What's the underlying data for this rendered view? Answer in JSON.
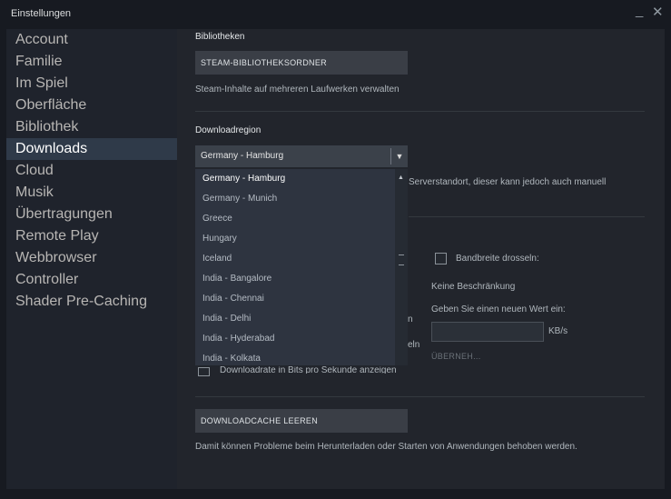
{
  "window": {
    "title": "Einstellungen",
    "minimize_glyph": "_",
    "close_glyph": "✕"
  },
  "sidebar": {
    "items": [
      {
        "label": "Account"
      },
      {
        "label": "Familie"
      },
      {
        "label": "Im Spiel"
      },
      {
        "label": "Oberfläche"
      },
      {
        "label": "Bibliothek"
      },
      {
        "label": "Downloads",
        "active": true
      },
      {
        "label": "Cloud"
      },
      {
        "label": "Musik"
      },
      {
        "label": "Übertragungen"
      },
      {
        "label": "Remote Play"
      },
      {
        "label": "Webbrowser"
      },
      {
        "label": "Controller"
      },
      {
        "label": "Shader Pre-Caching"
      }
    ]
  },
  "libraries": {
    "title": "Bibliotheken",
    "button": "STEAM-BIBLIOTHEKSORDNER",
    "description": "Steam-Inhalte auf mehreren Laufwerken verwalten"
  },
  "region": {
    "title": "Downloadregion",
    "selected": "Germany - Hamburg",
    "description_fragment": "Serverstandort, dieser kann jedoch auch manuell",
    "options": [
      "Germany - Hamburg",
      "Germany - Munich",
      "Greece",
      "Hungary",
      "Iceland",
      "India - Bangalore",
      "India - Chennai",
      "India - Delhi",
      "India - Hyderabad",
      "India - Kolkata"
    ]
  },
  "bandwidth": {
    "checkbox_label": "Bandbreite drosseln:",
    "status": "Keine Beschränkung",
    "prompt": "Geben Sie einen neuen Wert ein:",
    "input_value": "",
    "unit": "KB/s",
    "apply_button": "ÜBERNEH..."
  },
  "hidden_fragments": {
    "line1_tail": "n",
    "line2_tail": "eln",
    "bits_label": "Downloadrate in Bits pro Sekunde anzeigen"
  },
  "cache": {
    "button": "DOWNLOADCACHE LEEREN",
    "description": "Damit können Probleme beim Herunterladen oder Starten von Anwendungen behoben werden."
  },
  "colors": {
    "accent_active": "#2f3a49",
    "background": "#171a21",
    "panel": "#22252c"
  }
}
